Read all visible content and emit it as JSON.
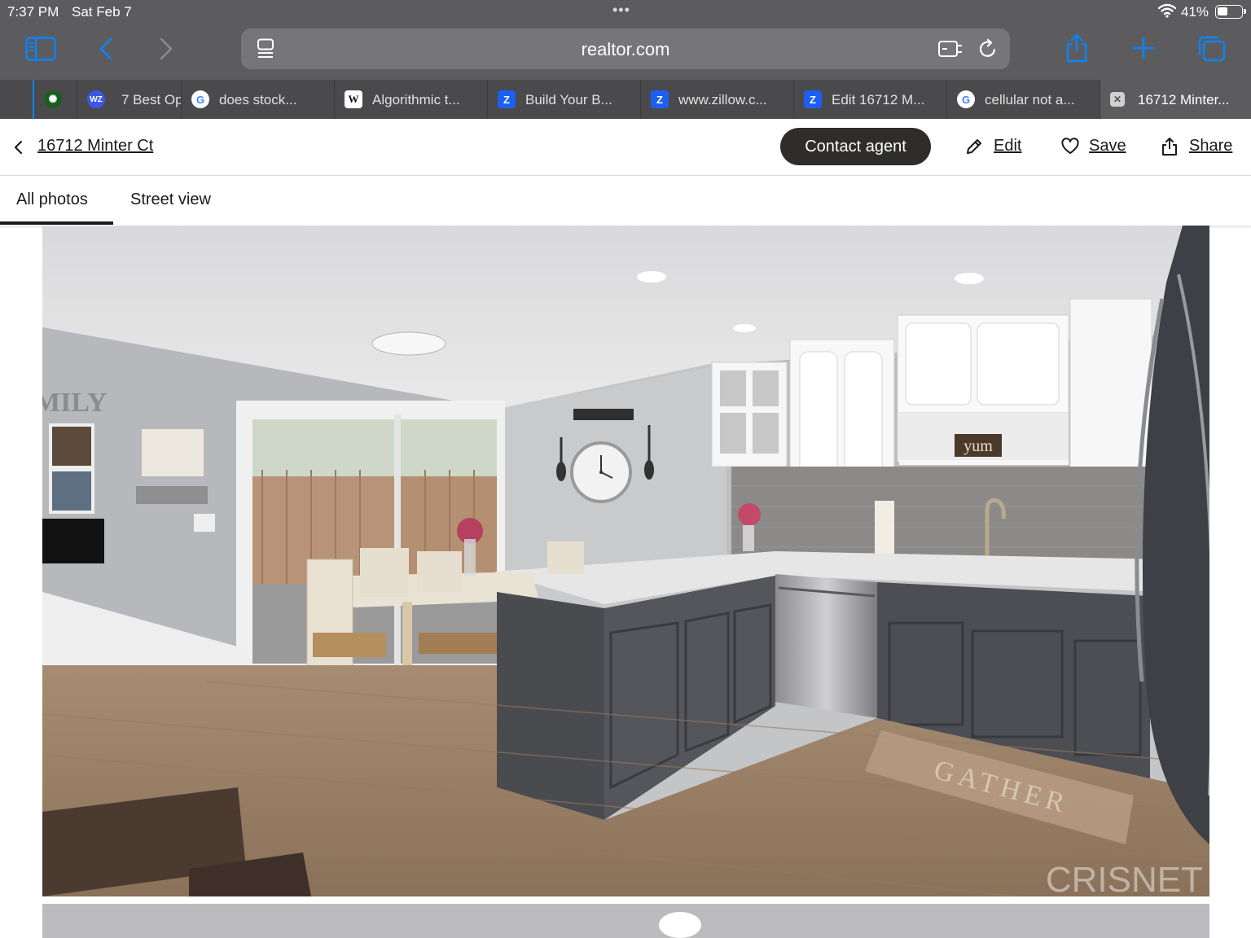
{
  "status_bar": {
    "time": "7:37 PM",
    "date": "Sat Feb 7",
    "dots": "•••",
    "battery": "41%"
  },
  "browser": {
    "url": "realtor.com",
    "tabs": [
      {
        "label": "",
        "favicon": "leaf-icon"
      },
      {
        "label": "7 Best Op",
        "favicon": "wz-icon"
      },
      {
        "label": "does stock...",
        "favicon": "google-icon"
      },
      {
        "label": "Algorithmic t...",
        "favicon": "wikipedia-icon"
      },
      {
        "label": "Build Your B...",
        "favicon": "zillow-icon"
      },
      {
        "label": "www.zillow.c...",
        "favicon": "zillow-icon"
      },
      {
        "label": "Edit 16712 M...",
        "favicon": "zillow-icon"
      },
      {
        "label": "cellular not a...",
        "favicon": "google-icon"
      },
      {
        "label": "16712 Minter...",
        "favicon": "close-icon",
        "active": true
      }
    ]
  },
  "listing": {
    "address": "16712 Minter Ct",
    "contact_label": "Contact agent",
    "edit_label": "Edit",
    "save_label": "Save",
    "share_label": "Share"
  },
  "photo_tabs": {
    "all_photos": "All photos",
    "street_view": "Street view"
  },
  "photo": {
    "description_alt": "kitchen",
    "wall_text": "MILY",
    "sign_text": "yum",
    "mat_text": "GATHER",
    "watermark": "CRISNET"
  },
  "colors": {
    "chrome": "#5c5c5e",
    "url_bar": "#767678",
    "accent_blue": "#0a84ff",
    "contact_button": "#2e2d2c"
  }
}
